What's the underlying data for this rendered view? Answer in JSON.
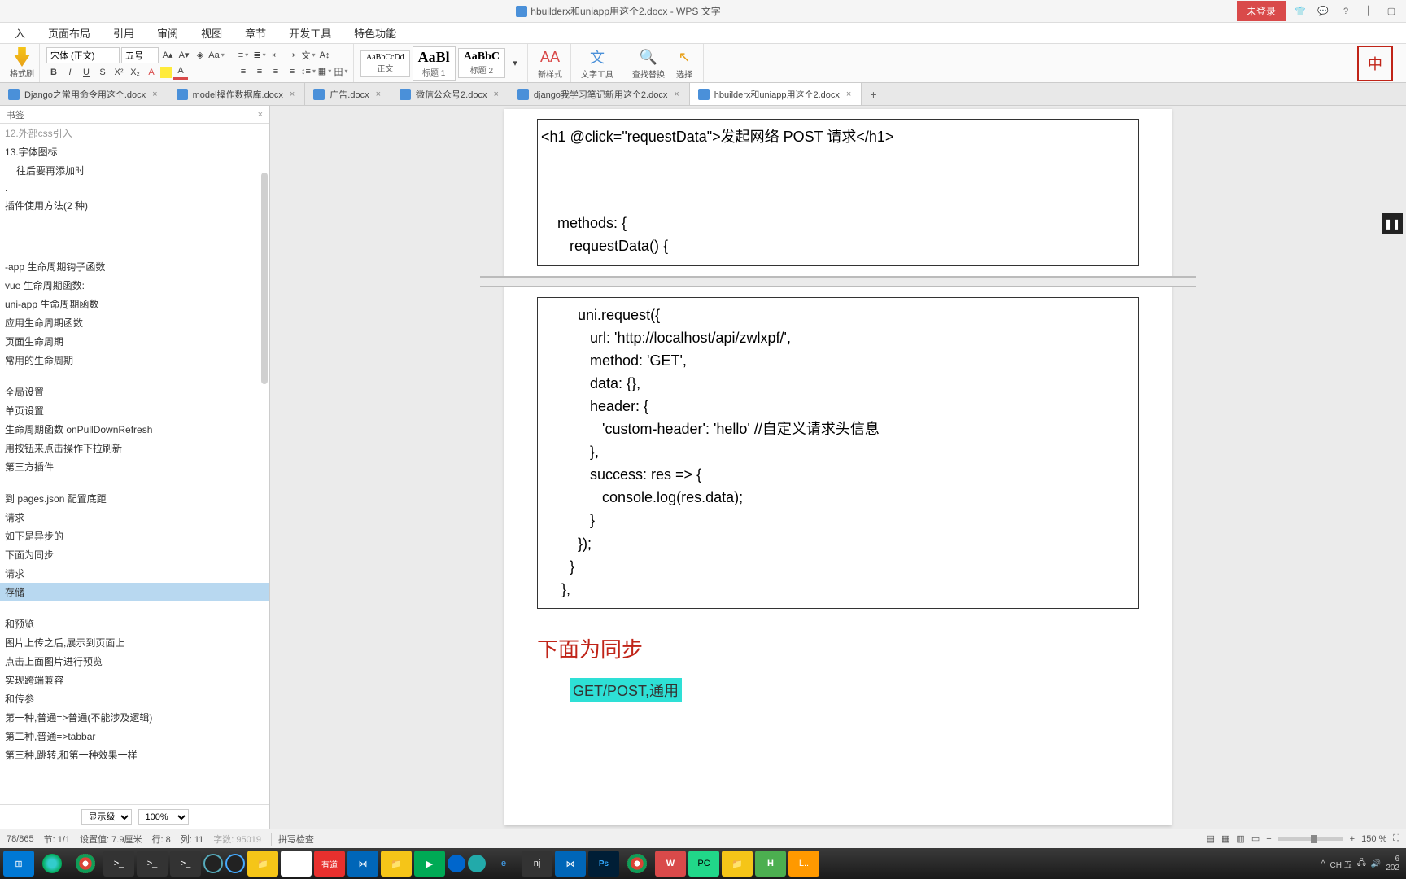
{
  "titlebar": {
    "filename": "hbuilderx和uniapp用这个2.docx - WPS 文字",
    "login": "未登录"
  },
  "menu": {
    "m1": "入",
    "m2": "页面布局",
    "m3": "引用",
    "m4": "审阅",
    "m5": "视图",
    "m6": "章节",
    "m7": "开发工具",
    "m8": "特色功能"
  },
  "ribbon": {
    "format_brush": "格式刷",
    "font_name": "宋体 (正文)",
    "font_size": "五号",
    "style_gallery": {
      "s1_prev": "AaBbCcDd",
      "s1_label": "正文",
      "s2_prev": "AaBl",
      "s2_label": "标题 1",
      "s3_prev": "AaBbC",
      "s3_label": "标题 2"
    },
    "new_style": "新样式",
    "text_tools": "文字工具",
    "find_replace": "查找替换",
    "select": "选择"
  },
  "tabs": {
    "t1": "Django之常用命令用这个.docx",
    "t2": "model操作数据库.docx",
    "t3": "广告.docx",
    "t4": "微信公众号2.docx",
    "t5": "django我学习笔记新用这个2.docx",
    "t6": "hbuilderx和uniapp用这个2.docx"
  },
  "sidebar": {
    "title": "书签",
    "items": {
      "i0": "12.外部css引入",
      "i1": "13.字体图标",
      "i2": "往后要再添加时",
      "i3": ".",
      "i4": "插件使用方法(2 种)",
      "i5": "-app 生命周期钩子函数",
      "i6": "vue 生命周期函数:",
      "i7": "uni-app 生命周期函数",
      "i8": "应用生命周期函数",
      "i9": "页面生命周期",
      "i10": "常用的生命周期",
      "i11": "全局设置",
      "i12": "单页设置",
      "i13": "生命周期函数 onPullDownRefresh",
      "i14": "用按钮来点击操作下拉刷新",
      "i15": "第三方插件",
      "i16": "到 pages.json 配置底距",
      "i17": "请求",
      "i18": "如下是异步的",
      "i19": "下面为同步",
      "i20": "请求",
      "i21": "存储",
      "i22": "和预览",
      "i23": "图片上传之后,展示到页面上",
      "i24": "点击上面图片进行预览",
      "i25": "实现跨端兼容",
      "i26": "和传参",
      "i27": "第一种,普通=>普通(不能涉及逻辑)",
      "i28": "第二种,普通=>tabbar",
      "i29": "第三种,跳转,和第一种效果一样"
    },
    "level_label": "显示级别",
    "zoom": "100%"
  },
  "document": {
    "box1_l1": "<h1 @click=\"requestData\">发起网络 POST 请求</h1>",
    "box1_l2": "    methods: {",
    "box1_l3": "       requestData() {",
    "box2_l1": "         uni.request({",
    "box2_l2": "            url: 'http://localhost/api/zwlxpf/',",
    "box2_l3": "            method: 'GET',",
    "box2_l4": "            data: {},",
    "box2_l5": "            header: {",
    "box2_l6": "               'custom-header': 'hello' //自定义请求头信息",
    "box2_l7": "            },",
    "box2_l8": "            success: res => {",
    "box2_l9": "               console.log(res.data);",
    "box2_l10": "            }",
    "box2_l11": "         });",
    "box2_l12": "       }",
    "box2_l13": "     },",
    "heading_red": "下面为同步",
    "highlight": "GET/POST,通用"
  },
  "statusbar": {
    "page": "78/865",
    "section": "节: 1/1",
    "pos": "设置值: 7.9厘米",
    "row": "行: 8",
    "col": "列: 11",
    "chars": "字数: 95019",
    "spell": "拼写检查",
    "zoom": "150 %"
  },
  "taskbar": {
    "tray_ime": "CH 五",
    "tray_time1": "6",
    "tray_time2": "202"
  },
  "seal": "中"
}
